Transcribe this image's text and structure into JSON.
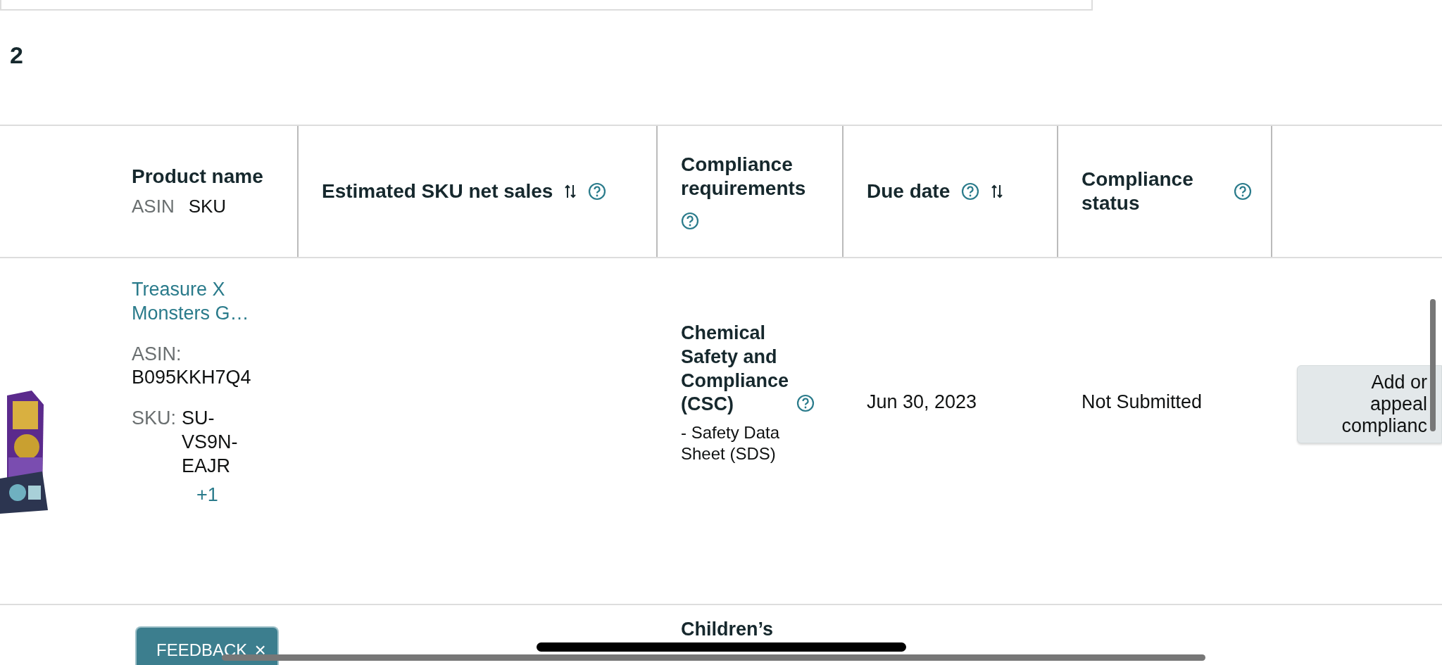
{
  "page_number": "2",
  "table": {
    "columns": [
      {
        "label": "Product name",
        "sublabels": [
          "ASIN",
          "SKU"
        ]
      },
      {
        "label": "Estimated SKU net sales",
        "icons": [
          {
            "kind": "sort"
          },
          {
            "kind": "help"
          }
        ]
      },
      {
        "label": "Compliance requirements",
        "icons": [
          {
            "kind": "help"
          }
        ]
      },
      {
        "label": "Due date",
        "icons": [
          {
            "kind": "help"
          },
          {
            "kind": "sort"
          }
        ]
      },
      {
        "label": "Compliance status",
        "icons": [
          {
            "kind": "help"
          }
        ]
      }
    ],
    "rows": [
      {
        "kind": "full",
        "product_name": "Treasure X Monsters G…",
        "asin_label": "ASIN:",
        "asin": "B095KKH7Q4",
        "sku_label": "SKU:",
        "sku": "SU-VS9N-EAJR",
        "more_skus": "+1",
        "requirement": "Chemical Safety and Compliance (CSC)",
        "requirement_detail": "- Safety Data Sheet (SDS)",
        "due_date": "Jun 30, 2023",
        "status": "Not Submitted",
        "action": "Add or appeal complianc"
      },
      {
        "kind": "partial",
        "requirement": "Children’s"
      }
    ]
  },
  "feedback": {
    "label": "FEEDBACK",
    "close": "×"
  }
}
